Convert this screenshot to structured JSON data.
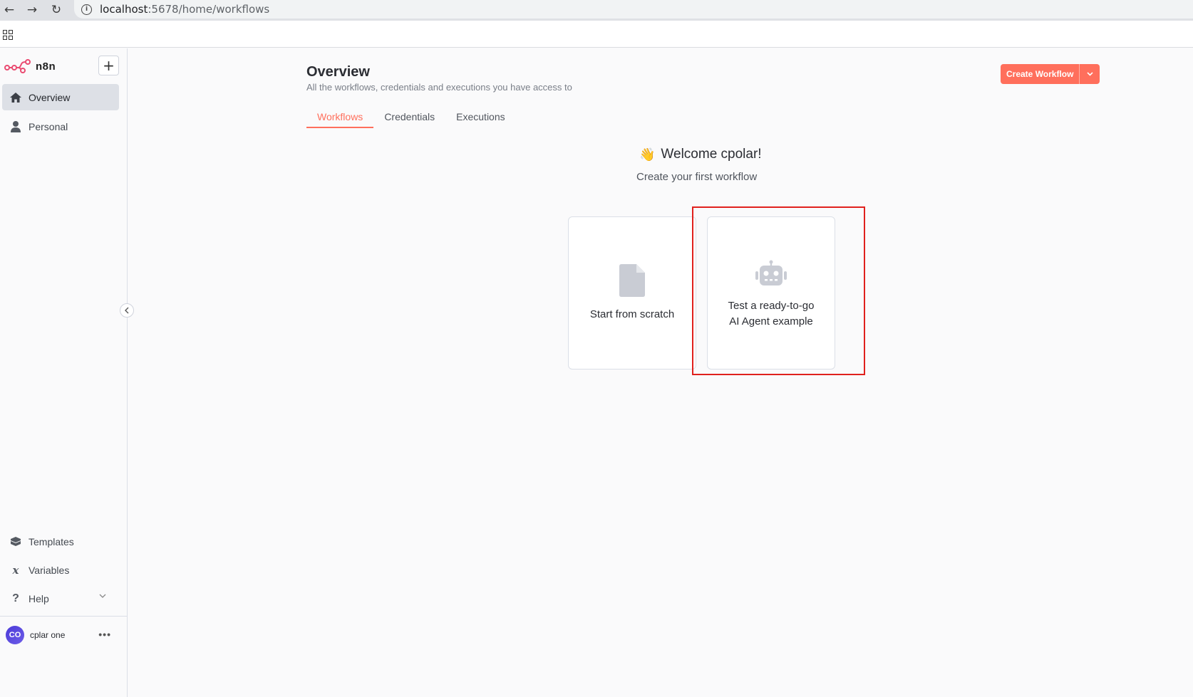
{
  "browser": {
    "url_host": "localhost",
    "url_path": ":5678/home/workflows",
    "back_glyph": "←",
    "forward_glyph": "→",
    "reload_glyph": "↻",
    "info_glyph": "i"
  },
  "sidebar": {
    "brand": "n8n",
    "add_glyph": "+",
    "items": [
      {
        "label": "Overview",
        "icon": "home-icon",
        "active": true
      },
      {
        "label": "Personal",
        "icon": "user-icon",
        "active": false
      }
    ],
    "bottom_items": [
      {
        "label": "Templates",
        "icon": "box-icon"
      },
      {
        "label": "Variables",
        "icon": "variable-icon"
      },
      {
        "label": "Help",
        "icon": "question-icon"
      }
    ],
    "user": {
      "initials": "CO",
      "name": "cplar one",
      "more": "•••"
    }
  },
  "main": {
    "title": "Overview",
    "subtitle": "All the workflows, credentials and executions you have access to",
    "create_button": "Create Workflow",
    "tabs": [
      {
        "label": "Workflows",
        "active": true
      },
      {
        "label": "Credentials",
        "active": false
      },
      {
        "label": "Executions",
        "active": false
      }
    ],
    "welcome": "Welcome cpolar!",
    "wave_glyph": "👋",
    "welcome_sub": "Create your first workflow",
    "cards": [
      {
        "label": "Start from scratch",
        "icon": "file-icon"
      },
      {
        "label_line1": "Test a ready-to-go",
        "label_line2": "AI Agent example",
        "icon": "robot-icon"
      }
    ]
  },
  "colors": {
    "accent": "#ff6f5c",
    "highlight": "#e0211d",
    "sidebar_active": "#dde0e6"
  }
}
